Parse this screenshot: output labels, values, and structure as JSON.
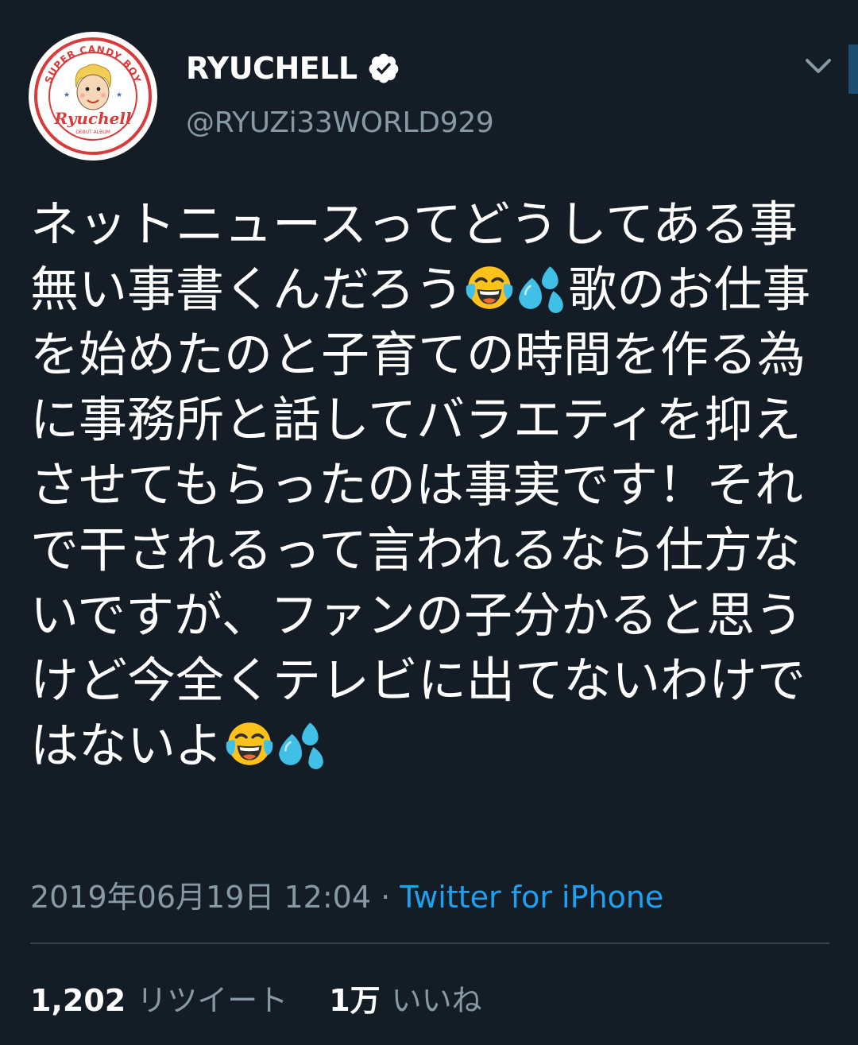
{
  "author": {
    "display_name": "RYUCHELL",
    "handle": "@RYUZi33WORLD929",
    "verified": true,
    "avatar": {
      "arc_text": "SUPER CANDY BOY",
      "script_text": "Ryuchell",
      "sub_text": "DEBUT ALBUM"
    }
  },
  "tweet": {
    "text_segments": [
      {
        "type": "text",
        "value": "ネットニュースってどうしてある事無い事書くんだろう"
      },
      {
        "type": "emoji",
        "name": "face-with-tears-of-joy-icon"
      },
      {
        "type": "emoji",
        "name": "sweat-droplets-icon"
      },
      {
        "type": "text",
        "value": "歌のお仕事を始めたのと子育ての時間を作る為に事務所と話してバラエティを抑えさせてもらったのは事実です！それで干されるって言われるなら仕方ないですが、ファンの子分かると思うけど今全くテレビに出てないわけではないよ"
      },
      {
        "type": "emoji",
        "name": "face-with-tears-of-joy-icon"
      },
      {
        "type": "emoji",
        "name": "sweat-droplets-icon"
      }
    ],
    "timestamp": "2019年06月19日 12:04",
    "separator": " · ",
    "source": "Twitter for iPhone"
  },
  "stats": {
    "retweets_count": "1,202",
    "retweets_label": "リツイート",
    "likes_count": "1万",
    "likes_label": "いいね"
  },
  "colors": {
    "background": "#141d26",
    "text_primary": "#ffffff",
    "text_secondary": "#8899a6",
    "link": "#1da1f2",
    "divider": "#38444d"
  }
}
